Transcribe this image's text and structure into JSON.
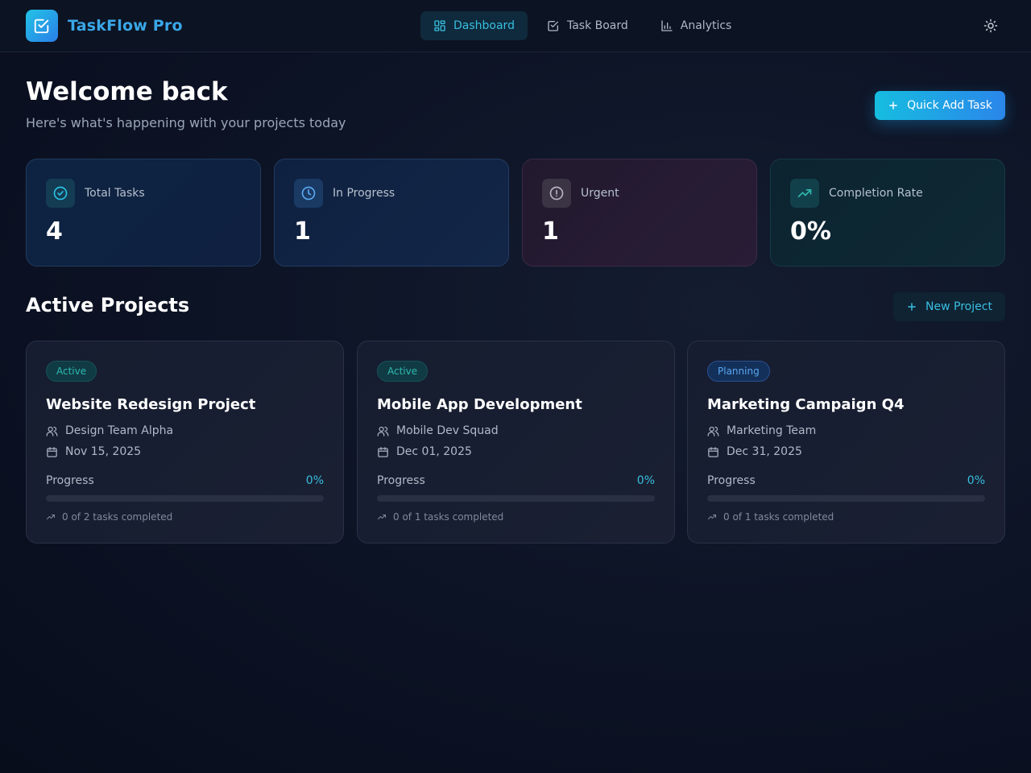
{
  "app": {
    "name": "TaskFlow Pro",
    "nav": [
      {
        "label": "Dashboard",
        "icon": "dashboard-grid-icon",
        "active": true
      },
      {
        "label": "Task Board",
        "icon": "checkbox-icon",
        "active": false
      },
      {
        "label": "Analytics",
        "icon": "bar-chart-icon",
        "active": false
      }
    ],
    "theme_icon": "sun-icon"
  },
  "header": {
    "title": "Welcome back",
    "subtitle": "Here's what's happening with your projects today",
    "quick_add_label": "Quick Add Task"
  },
  "stats": [
    {
      "label": "Total Tasks",
      "value": "4",
      "icon": "check-circle-icon",
      "color": "#2bc0e4"
    },
    {
      "label": "In Progress",
      "value": "1",
      "icon": "clock-icon",
      "color": "#5aa8f0"
    },
    {
      "label": "Urgent",
      "value": "1",
      "icon": "alert-circle-icon",
      "color": "#b8b2c2"
    },
    {
      "label": "Completion Rate",
      "value": "0%",
      "icon": "trending-up-icon",
      "color": "#2fb9b0"
    }
  ],
  "projects_section": {
    "title": "Active Projects",
    "new_label": "New Project"
  },
  "projects": [
    {
      "status": "Active",
      "title": "Website Redesign Project",
      "team": "Design Team Alpha",
      "date": "Nov 15, 2025",
      "progress_label": "Progress",
      "progress": "0%",
      "progress_fraction": 0,
      "tasks": "0 of 2 tasks completed"
    },
    {
      "status": "Active",
      "title": "Mobile App Development",
      "team": "Mobile Dev Squad",
      "date": "Dec 01, 2025",
      "progress_label": "Progress",
      "progress": "0%",
      "progress_fraction": 0,
      "tasks": "0 of 1 tasks completed"
    },
    {
      "status": "Planning",
      "title": "Marketing Campaign Q4",
      "team": "Marketing Team",
      "date": "Dec 31, 2025",
      "progress_label": "Progress",
      "progress": "0%",
      "progress_fraction": 0,
      "tasks": "0 of 1 tasks completed"
    }
  ],
  "colors": {
    "accent": "#38bfe0",
    "accent_gradient_end": "#2a86ea",
    "background": "#0d1426"
  }
}
